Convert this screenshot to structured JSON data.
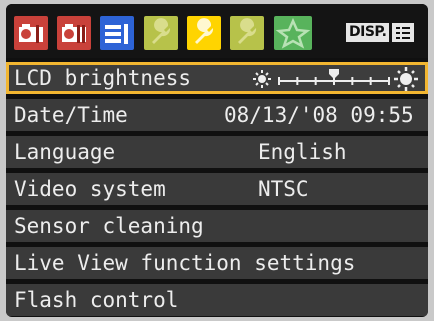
{
  "colors": {
    "shooting_tab": "#c9413a",
    "playback_tab": "#2d63d6",
    "setup_tab": "#b7c24a",
    "active_setup_tab": "#ffd400",
    "mymenu_tab": "#58b35c",
    "selection_border": "#f2b631",
    "row_bg": "#3a3a3a"
  },
  "tabs": [
    {
      "icon": "camera-icon",
      "active": false
    },
    {
      "icon": "camera-icon",
      "active": false
    },
    {
      "icon": "playback-icon",
      "active": false
    },
    {
      "icon": "wrench-icon",
      "active": false
    },
    {
      "icon": "wrench-icon",
      "active": true
    },
    {
      "icon": "wrench-icon",
      "active": false
    },
    {
      "icon": "star-icon",
      "active": false
    }
  ],
  "disp_label": "DISP.",
  "menu": [
    {
      "label": "LCD brightness",
      "value": "",
      "selected": true
    },
    {
      "label": "Date/Time",
      "value": "08/13/'08 09:55"
    },
    {
      "label": "Language",
      "value": "English"
    },
    {
      "label": "Video system",
      "value": "NTSC"
    },
    {
      "label": "Sensor cleaning",
      "value": ""
    },
    {
      "label": "Live View function settings",
      "value": ""
    },
    {
      "label": "Flash control",
      "value": ""
    }
  ],
  "brightness": {
    "level": 4,
    "max": 7
  }
}
